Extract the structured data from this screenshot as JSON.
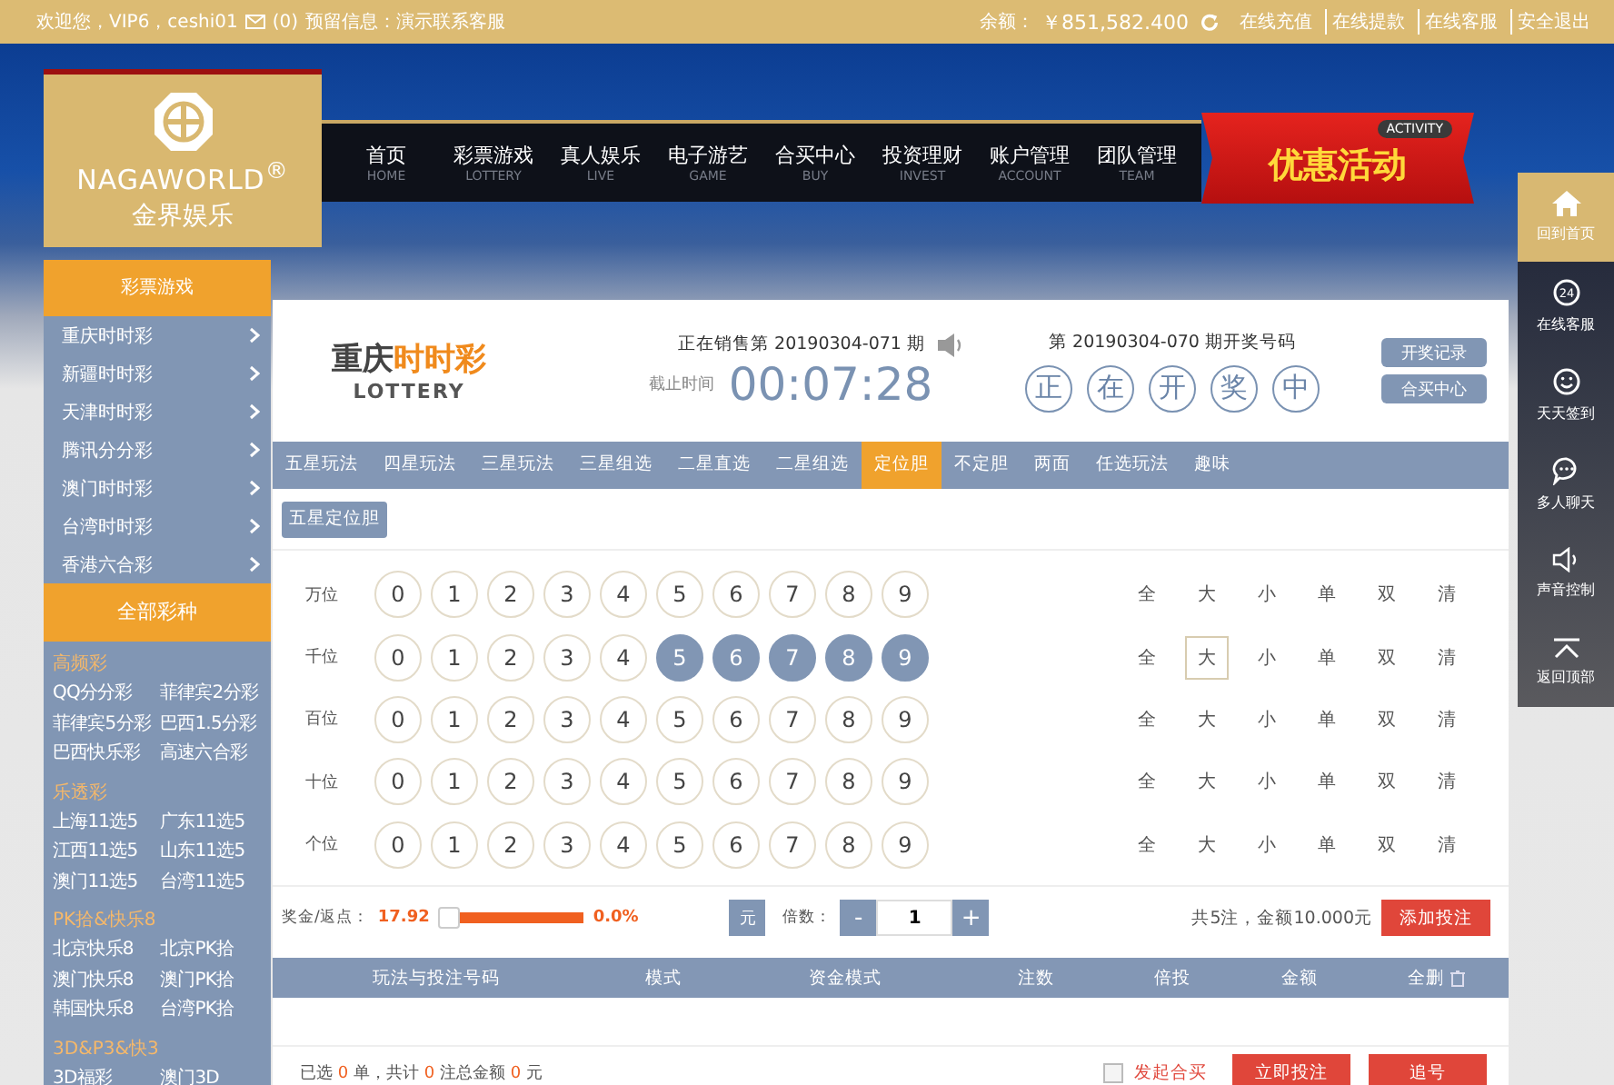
{
  "top_bar": {
    "greeting": "欢迎您，VIP6，ceshi01",
    "message_count": "(0)",
    "notice": "预留信息：演示联系客服",
    "balance_label": "余额：",
    "balance": "￥851,582.400",
    "links": [
      "在线充值",
      "在线提款",
      "在线客服",
      "安全退出"
    ]
  },
  "logo": {
    "brand": "NAGAWORLD$^{®}$",
    "subtitle": "金界娱乐"
  },
  "nav": [
    {
      "label": "首页",
      "sub": "HOME"
    },
    {
      "label": "彩票游戏",
      "sub": "LOTTERY"
    },
    {
      "label": "真人娱乐",
      "sub": "LIVE"
    },
    {
      "label": "电子游艺",
      "sub": "GAME"
    },
    {
      "label": "合买中心",
      "sub": "BUY"
    },
    {
      "label": "投资理财",
      "sub": "INVEST"
    },
    {
      "label": "账户管理",
      "sub": "ACCOUNT"
    },
    {
      "label": "团队管理",
      "sub": "TEAM"
    }
  ],
  "promo": {
    "badge": "ACTIVITY",
    "title": "优惠活动"
  },
  "sidebar": {
    "title": "彩票游戏",
    "items": [
      "重庆时时彩",
      "新疆时时彩",
      "天津时时彩",
      "腾讯分分彩",
      "澳门时时彩",
      "台湾时时彩",
      "香港六合彩"
    ],
    "all_title": "全部彩种",
    "groups": [
      {
        "title": "高频彩",
        "items": [
          "QQ分分彩",
          "菲律宾2分彩",
          "菲律宾5分彩",
          "巴西1.5分彩",
          "巴西快乐彩",
          "高速六合彩"
        ]
      },
      {
        "title": "乐透彩",
        "items": [
          "上海11选5",
          "广东11选5",
          "江西11选5",
          "山东11选5",
          "澳门11选5",
          "台湾11选5"
        ]
      },
      {
        "title": "PK拾&快乐8",
        "items": [
          "北京快乐8",
          "北京PK拾",
          "澳门快乐8",
          "澳门PK拾",
          "韩国快乐8",
          "台湾PK拾"
        ]
      },
      {
        "title": "3D&P3&快3",
        "items": [
          "3D福彩",
          "澳门3D"
        ]
      }
    ]
  },
  "game": {
    "name_a": "重庆",
    "name_b": "时时彩",
    "subtitle": "LOTTERY",
    "current_issue": "正在销售第 20190304-071 期",
    "deadline_label": "截止时间",
    "countdown": "00:07:28",
    "last_issue": "第 20190304-070 期开奖号码",
    "draw_chars": [
      "正",
      "在",
      "开",
      "奖",
      "中"
    ],
    "buttons": [
      "开奖记录",
      "合买中心"
    ]
  },
  "play_tabs": [
    {
      "label": "五星玩法",
      "selected": false
    },
    {
      "label": "四星玩法",
      "selected": false
    },
    {
      "label": "三星玩法",
      "selected": false
    },
    {
      "label": "三星组选",
      "selected": false
    },
    {
      "label": "二星直选",
      "selected": false
    },
    {
      "label": "二星组选",
      "selected": false
    },
    {
      "label": "定位胆",
      "selected": true
    },
    {
      "label": "不定胆",
      "selected": false
    },
    {
      "label": "两面",
      "selected": false
    },
    {
      "label": "任选玩法",
      "selected": false
    },
    {
      "label": "趣味",
      "selected": false
    }
  ],
  "sub_tab": "五星定位胆",
  "positions": [
    {
      "label": "万位",
      "balls": [
        {
          "n": "0",
          "selected": false
        },
        {
          "n": "1",
          "selected": false
        },
        {
          "n": "2",
          "selected": false
        },
        {
          "n": "3",
          "selected": false
        },
        {
          "n": "4",
          "selected": false
        },
        {
          "n": "5",
          "selected": false
        },
        {
          "n": "6",
          "selected": false
        },
        {
          "n": "7",
          "selected": false
        },
        {
          "n": "8",
          "selected": false
        },
        {
          "n": "9",
          "selected": false
        }
      ],
      "quick": [
        {
          "label": "全",
          "selected": false
        },
        {
          "label": "大",
          "selected": false
        },
        {
          "label": "小",
          "selected": false
        },
        {
          "label": "单",
          "selected": false
        },
        {
          "label": "双",
          "selected": false
        },
        {
          "label": "清",
          "selected": false
        }
      ]
    },
    {
      "label": "千位",
      "balls": [
        {
          "n": "0",
          "selected": false
        },
        {
          "n": "1",
          "selected": false
        },
        {
          "n": "2",
          "selected": false
        },
        {
          "n": "3",
          "selected": false
        },
        {
          "n": "4",
          "selected": false
        },
        {
          "n": "5",
          "selected": true
        },
        {
          "n": "6",
          "selected": true
        },
        {
          "n": "7",
          "selected": true
        },
        {
          "n": "8",
          "selected": true
        },
        {
          "n": "9",
          "selected": true
        }
      ],
      "quick": [
        {
          "label": "全",
          "selected": false
        },
        {
          "label": "大",
          "selected": true
        },
        {
          "label": "小",
          "selected": false
        },
        {
          "label": "单",
          "selected": false
        },
        {
          "label": "双",
          "selected": false
        },
        {
          "label": "清",
          "selected": false
        }
      ]
    },
    {
      "label": "百位",
      "balls": [
        {
          "n": "0",
          "selected": false
        },
        {
          "n": "1",
          "selected": false
        },
        {
          "n": "2",
          "selected": false
        },
        {
          "n": "3",
          "selected": false
        },
        {
          "n": "4",
          "selected": false
        },
        {
          "n": "5",
          "selected": false
        },
        {
          "n": "6",
          "selected": false
        },
        {
          "n": "7",
          "selected": false
        },
        {
          "n": "8",
          "selected": false
        },
        {
          "n": "9",
          "selected": false
        }
      ],
      "quick": [
        {
          "label": "全",
          "selected": false
        },
        {
          "label": "大",
          "selected": false
        },
        {
          "label": "小",
          "selected": false
        },
        {
          "label": "单",
          "selected": false
        },
        {
          "label": "双",
          "selected": false
        },
        {
          "label": "清",
          "selected": false
        }
      ]
    },
    {
      "label": "十位",
      "balls": [
        {
          "n": "0",
          "selected": false
        },
        {
          "n": "1",
          "selected": false
        },
        {
          "n": "2",
          "selected": false
        },
        {
          "n": "3",
          "selected": false
        },
        {
          "n": "4",
          "selected": false
        },
        {
          "n": "5",
          "selected": false
        },
        {
          "n": "6",
          "selected": false
        },
        {
          "n": "7",
          "selected": false
        },
        {
          "n": "8",
          "selected": false
        },
        {
          "n": "9",
          "selected": false
        }
      ],
      "quick": [
        {
          "label": "全",
          "selected": false
        },
        {
          "label": "大",
          "selected": false
        },
        {
          "label": "小",
          "selected": false
        },
        {
          "label": "单",
          "selected": false
        },
        {
          "label": "双",
          "selected": false
        },
        {
          "label": "清",
          "selected": false
        }
      ]
    },
    {
      "label": "个位",
      "balls": [
        {
          "n": "0",
          "selected": false
        },
        {
          "n": "1",
          "selected": false
        },
        {
          "n": "2",
          "selected": false
        },
        {
          "n": "3",
          "selected": false
        },
        {
          "n": "4",
          "selected": false
        },
        {
          "n": "5",
          "selected": false
        },
        {
          "n": "6",
          "selected": false
        },
        {
          "n": "7",
          "selected": false
        },
        {
          "n": "8",
          "selected": false
        },
        {
          "n": "9",
          "selected": false
        }
      ],
      "quick": [
        {
          "label": "全",
          "selected": false
        },
        {
          "label": "大",
          "selected": false
        },
        {
          "label": "小",
          "selected": false
        },
        {
          "label": "单",
          "selected": false
        },
        {
          "label": "双",
          "selected": false
        },
        {
          "label": "清",
          "selected": false
        }
      ]
    }
  ],
  "bet_bar": {
    "rebate_label": "奖金/返点：",
    "prize": "17.92",
    "level": 0,
    "percent": "0.0%",
    "unit": "元",
    "multiplier_label": "倍数：",
    "minus": "-",
    "multiplier": "1",
    "plus": "+",
    "summary": "共5注，金额10.000元",
    "add_button": "添加投注"
  },
  "table": {
    "columns": [
      "玩法与投注号码",
      "模式",
      "资金模式",
      "注数",
      "倍投",
      "金额",
      "全删"
    ]
  },
  "footer": {
    "summary": [
      {
        "text": "已选 ",
        "kind": "plain"
      },
      {
        "text": "0",
        "kind": "num"
      },
      {
        "text": " 单，共计 ",
        "kind": "plain"
      },
      {
        "text": "0",
        "kind": "num"
      },
      {
        "text": " 注总金额 ",
        "kind": "plain"
      },
      {
        "text": "0",
        "kind": "num"
      },
      {
        "text": " 元",
        "kind": "plain"
      }
    ],
    "joint_buy": {
      "label": "发起合买",
      "checked": false
    },
    "buttons": [
      "立即投注",
      "追号"
    ]
  },
  "right_tools": [
    {
      "label": "回到首页",
      "kind": "home",
      "selected": true
    },
    {
      "label": "在线客服",
      "kind": "support",
      "icon_text": "24",
      "selected": false
    },
    {
      "label": "天天签到",
      "kind": "smile",
      "selected": false
    },
    {
      "label": "多人聊天",
      "kind": "chat",
      "selected": false
    },
    {
      "label": "声音控制",
      "kind": "sound",
      "selected": false
    },
    {
      "label": "返回顶部",
      "kind": "top",
      "selected": false
    }
  ]
}
